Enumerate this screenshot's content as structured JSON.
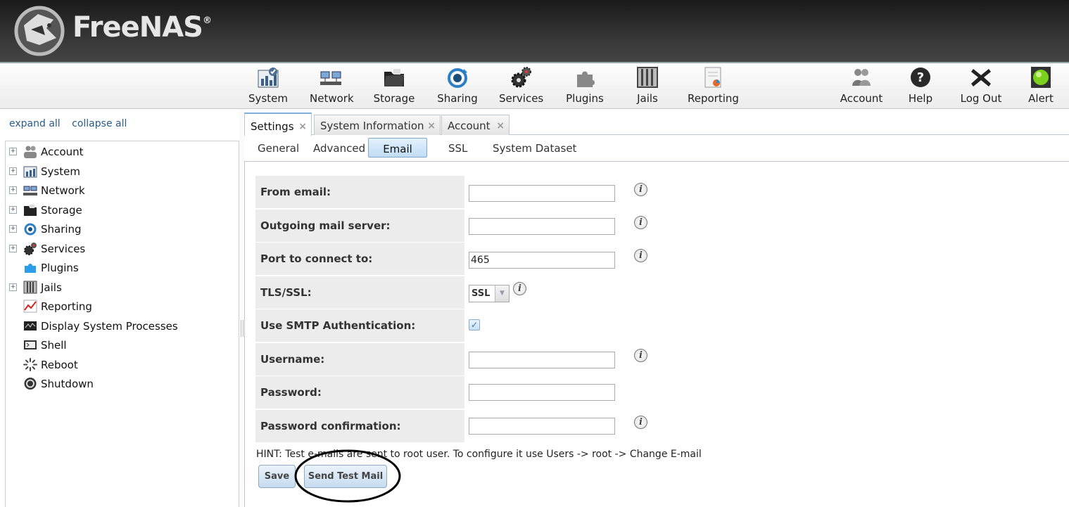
{
  "app": {
    "logo_text": "FreeNAS",
    "logo_mark": "®"
  },
  "toolbar": {
    "items": [
      {
        "label": "System",
        "icon": "system-chart-icon"
      },
      {
        "label": "Network",
        "icon": "network-icon"
      },
      {
        "label": "Storage",
        "icon": "folder-icon"
      },
      {
        "label": "Sharing",
        "icon": "sharing-icon"
      },
      {
        "label": "Services",
        "icon": "gears-icon"
      },
      {
        "label": "Plugins",
        "icon": "plugins-icon"
      },
      {
        "label": "Jails",
        "icon": "jails-icon"
      },
      {
        "label": "Reporting",
        "icon": "report-icon"
      }
    ],
    "right_items": [
      {
        "label": "Account",
        "icon": "users-icon"
      },
      {
        "label": "Help",
        "icon": "help-icon"
      },
      {
        "label": "Log Out",
        "icon": "logout-x-icon"
      },
      {
        "label": "Alert",
        "icon": "alert-light-icon"
      }
    ]
  },
  "sidebar": {
    "expand_all": "expand all",
    "collapse_all": "collapse all",
    "items": [
      {
        "label": "Account",
        "expandable": true
      },
      {
        "label": "System",
        "expandable": true
      },
      {
        "label": "Network",
        "expandable": true
      },
      {
        "label": "Storage",
        "expandable": true
      },
      {
        "label": "Sharing",
        "expandable": true
      },
      {
        "label": "Services",
        "expandable": true
      },
      {
        "label": "Plugins",
        "expandable": false
      },
      {
        "label": "Jails",
        "expandable": true
      },
      {
        "label": "Reporting",
        "expandable": false
      },
      {
        "label": "Display System Processes",
        "expandable": false
      },
      {
        "label": "Shell",
        "expandable": false
      },
      {
        "label": "Reboot",
        "expandable": false
      },
      {
        "label": "Shutdown",
        "expandable": false
      }
    ]
  },
  "tabs": [
    {
      "label": "Settings",
      "active": true
    },
    {
      "label": "System Information",
      "active": false
    },
    {
      "label": "Account",
      "active": false
    }
  ],
  "subtabs": [
    {
      "label": "General"
    },
    {
      "label": "Advanced"
    },
    {
      "label": "Email",
      "active": true
    },
    {
      "label": "SSL"
    },
    {
      "label": "System Dataset"
    }
  ],
  "form": {
    "from_email": {
      "label": "From email:",
      "value": ""
    },
    "outgoing_mail_server": {
      "label": "Outgoing mail server:",
      "value": ""
    },
    "port": {
      "label": "Port to connect to:",
      "value": "465"
    },
    "tls_ssl": {
      "label": "TLS/SSL:",
      "value": "SSL"
    },
    "smtp_auth": {
      "label": "Use SMTP Authentication:",
      "checked": true
    },
    "username": {
      "label": "Username:",
      "value": ""
    },
    "password": {
      "label": "Password:",
      "value": ""
    },
    "password_confirmation": {
      "label": "Password confirmation:",
      "value": ""
    },
    "info_glyph": "i"
  },
  "hint": "HINT: Test e-mails are sent to root user. To configure it use Users -> root -> Change E-mail",
  "buttons": {
    "save": "Save",
    "send_test_mail": "Send Test Mail"
  },
  "glyphs": {
    "close": "×",
    "expand": "+",
    "check": "✓",
    "dropdown": "▼"
  }
}
